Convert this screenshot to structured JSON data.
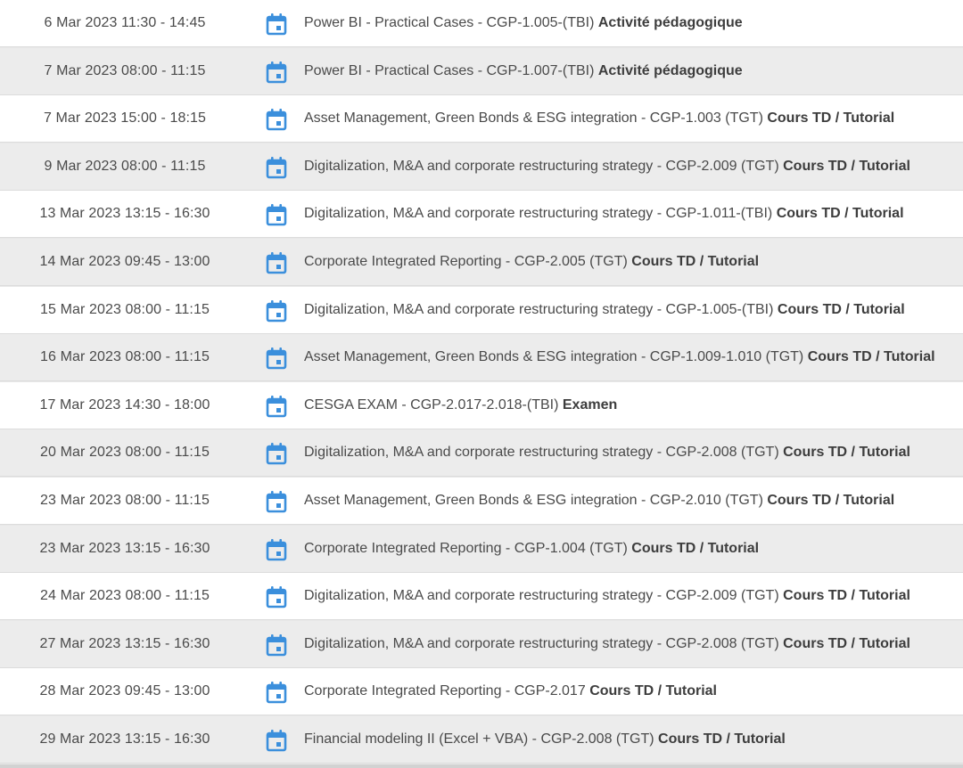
{
  "colors": {
    "icon_blue": "#3b8fdc",
    "row_white": "#ffffff",
    "row_grey": "#ececec",
    "text": "#4a4a4a"
  },
  "icon_name": "calendar-icon",
  "events": [
    {
      "datetime": "6 Mar 2023 11:30 - 14:45",
      "title": "Power BI - Practical Cases - CGP-1.005-(TBI)",
      "type": "Activité pédagogique"
    },
    {
      "datetime": "7 Mar 2023 08:00 - 11:15",
      "title": "Power BI - Practical Cases - CGP-1.007-(TBI)",
      "type": "Activité pédagogique"
    },
    {
      "datetime": "7 Mar 2023 15:00 - 18:15",
      "title": "Asset Management, Green Bonds & ESG integration - CGP-1.003 (TGT)",
      "type": "Cours TD / Tutorial"
    },
    {
      "datetime": "9 Mar 2023 08:00 - 11:15",
      "title": "Digitalization, M&A and corporate restructuring strategy - CGP-2.009 (TGT)",
      "type": "Cours TD / Tutorial"
    },
    {
      "datetime": "13 Mar 2023 13:15 - 16:30",
      "title": "Digitalization, M&A and corporate restructuring strategy - CGP-1.011-(TBI)",
      "type": "Cours TD / Tutorial"
    },
    {
      "datetime": "14 Mar 2023 09:45 - 13:00",
      "title": "Corporate Integrated Reporting - CGP-2.005 (TGT)",
      "type": "Cours TD / Tutorial"
    },
    {
      "datetime": "15 Mar 2023 08:00 - 11:15",
      "title": "Digitalization, M&A and corporate restructuring strategy - CGP-1.005-(TBI)",
      "type": "Cours TD / Tutorial"
    },
    {
      "datetime": "16 Mar 2023 08:00 - 11:15",
      "title": "Asset Management, Green Bonds & ESG integration - CGP-1.009-1.010 (TGT)",
      "type": "Cours TD / Tutorial"
    },
    {
      "datetime": "17 Mar 2023 14:30 - 18:00",
      "title": "CESGA EXAM - CGP-2.017-2.018-(TBI)",
      "type": "Examen"
    },
    {
      "datetime": "20 Mar 2023 08:00 - 11:15",
      "title": "Digitalization, M&A and corporate restructuring strategy - CGP-2.008 (TGT)",
      "type": "Cours TD / Tutorial"
    },
    {
      "datetime": "23 Mar 2023 08:00 - 11:15",
      "title": "Asset Management, Green Bonds & ESG integration - CGP-2.010 (TGT)",
      "type": "Cours TD / Tutorial"
    },
    {
      "datetime": "23 Mar 2023 13:15 - 16:30",
      "title": "Corporate Integrated Reporting - CGP-1.004 (TGT)",
      "type": "Cours TD / Tutorial"
    },
    {
      "datetime": "24 Mar 2023 08:00 - 11:15",
      "title": "Digitalization, M&A and corporate restructuring strategy - CGP-2.009 (TGT)",
      "type": "Cours TD / Tutorial"
    },
    {
      "datetime": "27 Mar 2023 13:15 - 16:30",
      "title": "Digitalization, M&A and corporate restructuring strategy - CGP-2.008 (TGT)",
      "type": "Cours TD / Tutorial"
    },
    {
      "datetime": "28 Mar 2023 09:45 - 13:00",
      "title": "Corporate Integrated Reporting - CGP-2.017",
      "type": "Cours TD / Tutorial"
    },
    {
      "datetime": "29 Mar 2023 13:15 - 16:30",
      "title": "Financial modeling II (Excel + VBA) - CGP-2.008 (TGT)",
      "type": "Cours TD / Tutorial"
    }
  ]
}
